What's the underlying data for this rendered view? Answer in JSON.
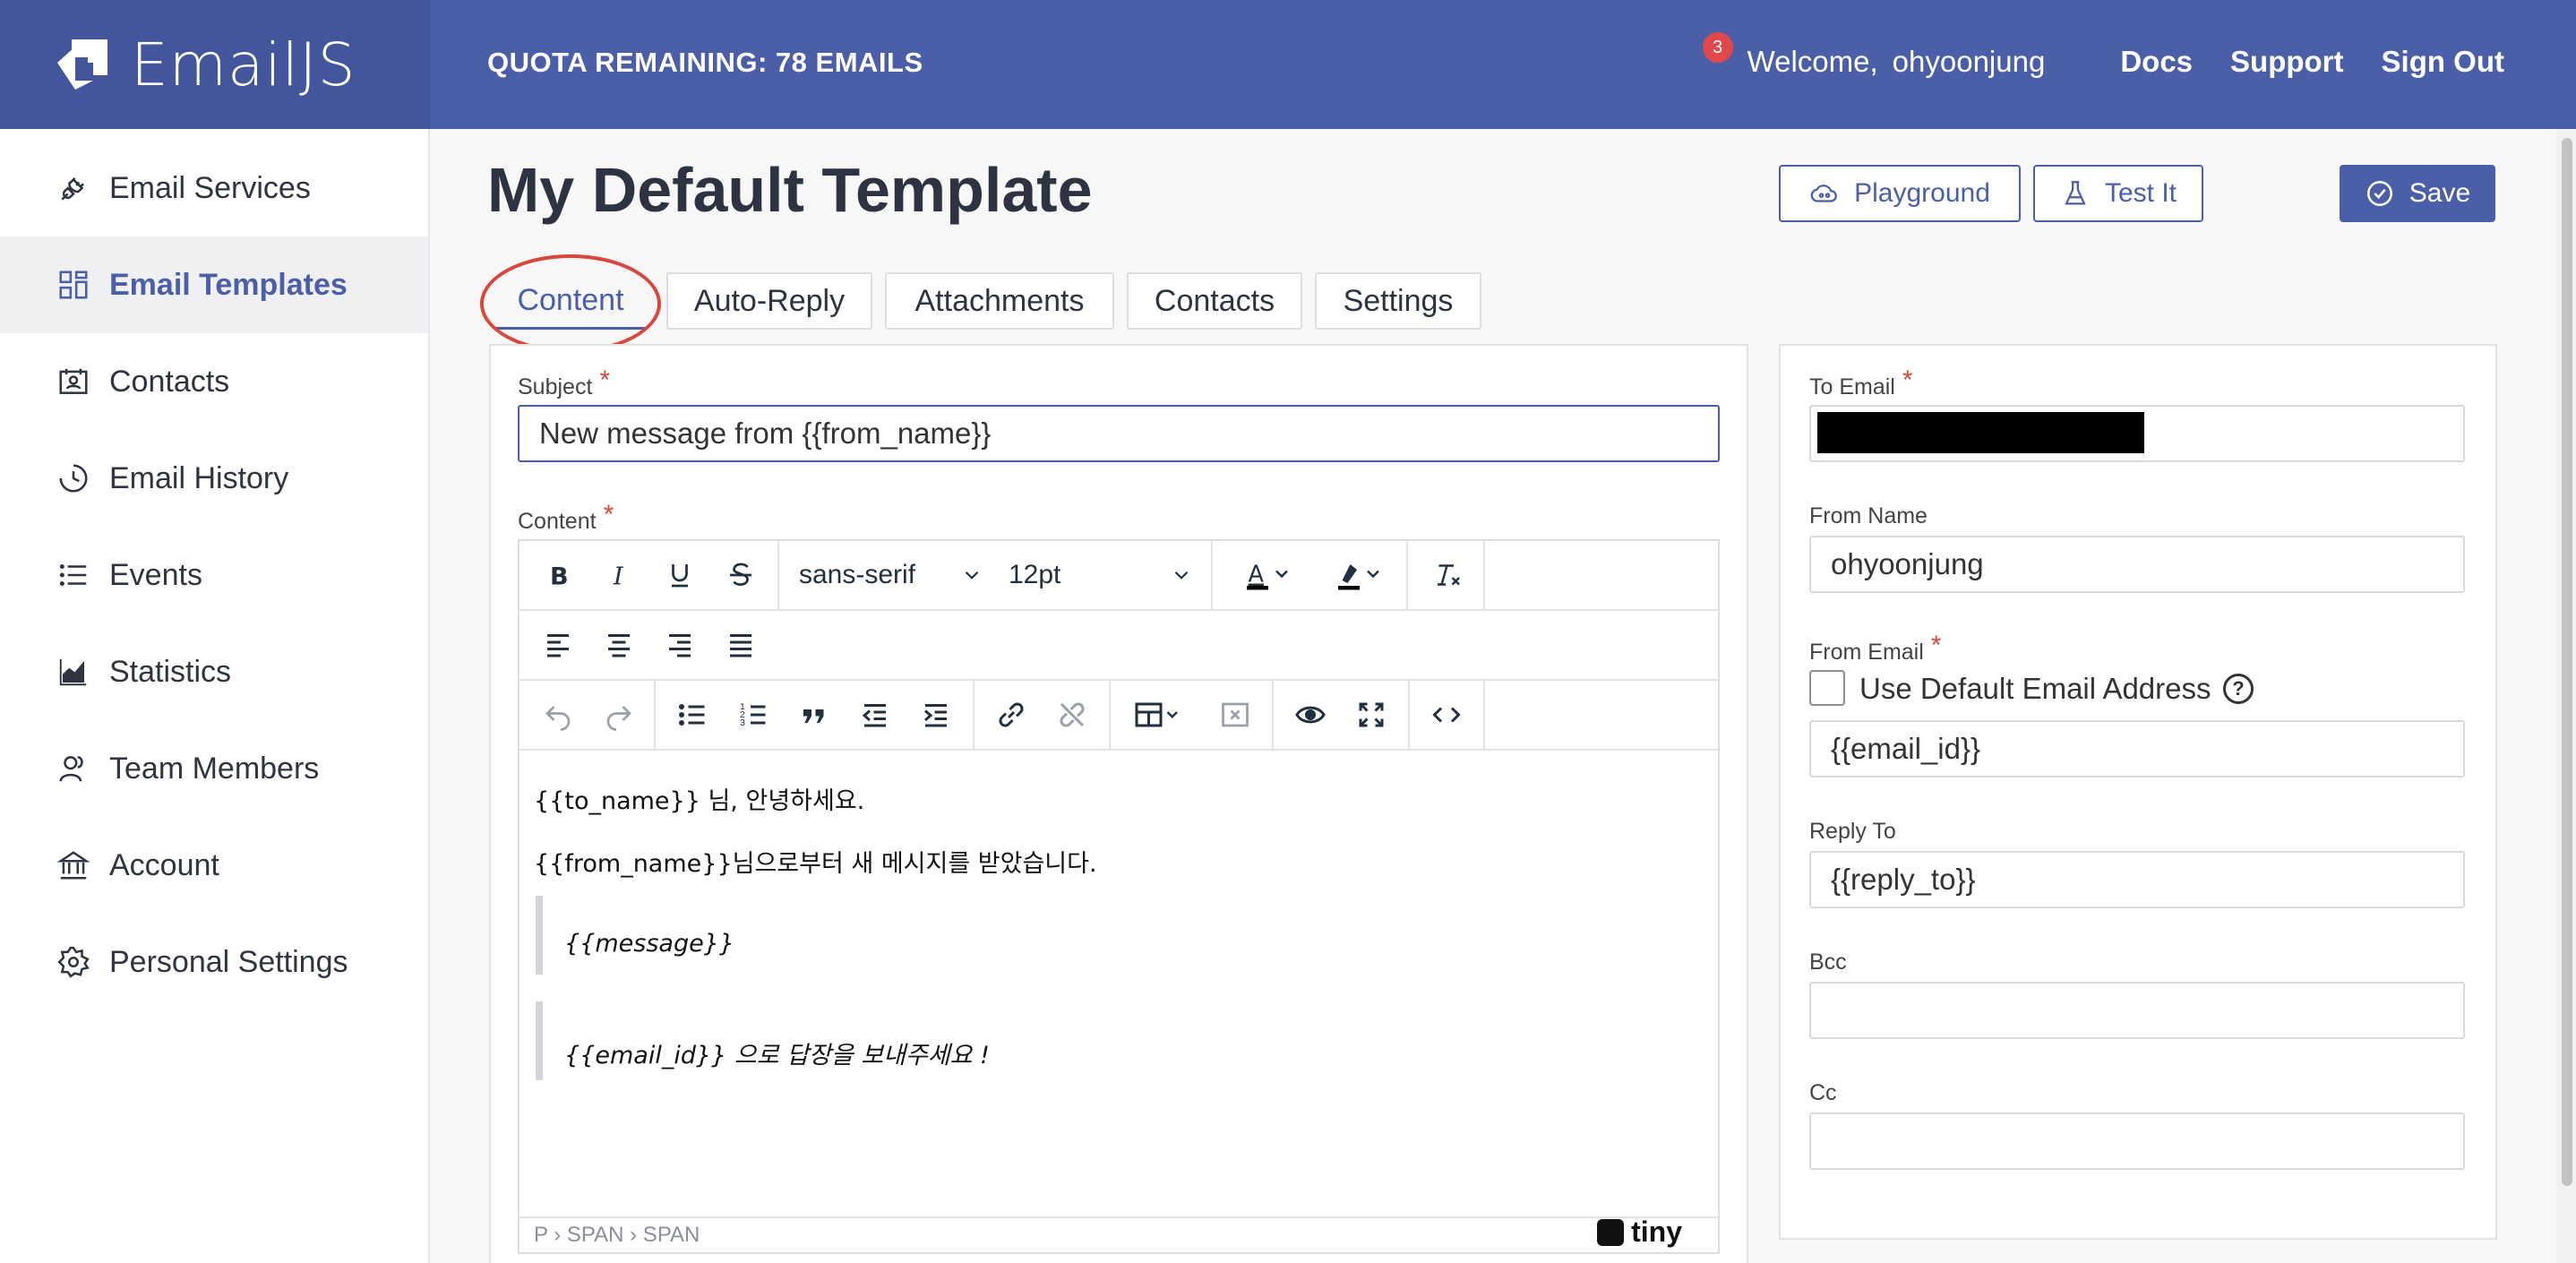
{
  "header": {
    "brand": "EmailJS",
    "quota": "QUOTA REMAINING: 78 EMAILS",
    "notification_count": "3",
    "welcome": "Welcome,",
    "username": "ohyoonjung",
    "links": [
      "Docs",
      "Support",
      "Sign Out"
    ]
  },
  "sidebar": {
    "items": [
      {
        "label": "Email Services",
        "icon": "plug-icon"
      },
      {
        "label": "Email Templates",
        "icon": "templates-icon",
        "active": true
      },
      {
        "label": "Contacts",
        "icon": "contacts-icon"
      },
      {
        "label": "Email History",
        "icon": "history-icon"
      },
      {
        "label": "Events",
        "icon": "list-icon"
      },
      {
        "label": "Statistics",
        "icon": "chart-icon"
      },
      {
        "label": "Team Members",
        "icon": "team-icon"
      },
      {
        "label": "Account",
        "icon": "bank-icon"
      },
      {
        "label": "Personal Settings",
        "icon": "gear-icon"
      }
    ]
  },
  "main": {
    "title": "My Default Template",
    "actions": {
      "playground": "Playground",
      "test": "Test It",
      "save": "Save"
    },
    "tabs": [
      "Content",
      "Auto-Reply",
      "Attachments",
      "Contacts",
      "Settings"
    ],
    "active_tab": "Content"
  },
  "editor": {
    "subject_label": "Subject",
    "subject_value": "New message from {{from_name}}",
    "content_label": "Content",
    "required_mark": "*",
    "font_family": "sans-serif",
    "font_size": "12pt",
    "body": {
      "line1": "{{to_name}} 님, 안녕하세요.",
      "line2": "{{from_name}}님으로부터 새 메시지를 받았습니다.",
      "quote1": "{{message}}",
      "quote2": "{{email_id}} 으로 답장을 보내주세요 !"
    },
    "statusbar_path": "P › SPAN › SPAN",
    "powered_by": "tiny"
  },
  "settings_panel": {
    "to_email_label": "To Email",
    "to_email_value": "",
    "from_name_label": "From Name",
    "from_name_value": "ohyoonjung",
    "from_email_label": "From Email",
    "use_default_label": "Use Default Email Address",
    "use_default_checked": false,
    "from_email_value": "{{email_id}}",
    "reply_to_label": "Reply To",
    "reply_to_value": "{{reply_to}}",
    "bcc_label": "Bcc",
    "bcc_value": "",
    "cc_label": "Cc",
    "cc_value": ""
  },
  "colors": {
    "primary": "#4b5fa8",
    "required": "#d9463b",
    "annotation": "#d9463b"
  }
}
